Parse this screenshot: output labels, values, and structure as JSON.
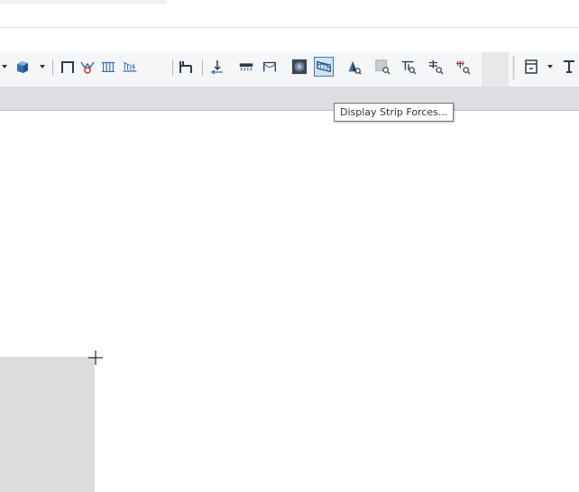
{
  "toolbar": {
    "buttons": [
      {
        "name": "solid-cube-button",
        "icon": "solid-cube-icon",
        "dropdown": true
      },
      {
        "name": "frame-button",
        "icon": "frame-portal-icon"
      },
      {
        "name": "spring-support-button",
        "icon": "spring-icon"
      },
      {
        "name": "wall-grid-button",
        "icon": "wall-grid-icon"
      },
      {
        "name": "line-load-button",
        "icon": "distributed-load-icon"
      },
      {
        "name": "frame-section-button",
        "icon": "frame-section-icon"
      },
      {
        "name": "joint-force-button",
        "icon": "joint-force-icon"
      },
      {
        "name": "area-load-button",
        "icon": "area-load-icon"
      },
      {
        "name": "cable-button",
        "icon": "cable-icon"
      },
      {
        "name": "contour-display-button",
        "icon": "contour-icon"
      },
      {
        "name": "display-strip-forces-button",
        "icon": "strip-forces-icon",
        "active": true
      },
      {
        "name": "punching-check-button",
        "icon": "punching-shear-icon"
      },
      {
        "name": "area-query-button",
        "icon": "area-query-icon"
      },
      {
        "name": "tendon-query-button",
        "icon": "tendon-query-icon"
      },
      {
        "name": "beam-query-button",
        "icon": "beam-query-icon"
      },
      {
        "name": "dimension-query-button",
        "icon": "dimension-query-icon"
      },
      {
        "name": "window-view-button",
        "icon": "window-icon",
        "dropdown": true
      },
      {
        "name": "text-tool-button",
        "icon": "text-tool-icon"
      }
    ]
  },
  "tooltip": {
    "text": "Display Strip Forces..."
  },
  "colors": {
    "toolbar_bg": "#f5f6f7",
    "subbar_bg": "#dcdee1",
    "active_fill": "#cce4f7",
    "active_border": "#3c7fb1",
    "icon_blue": "#3b6fb3",
    "icon_dark": "#2d3a4a",
    "panel_grey": "#dcdcdc"
  }
}
